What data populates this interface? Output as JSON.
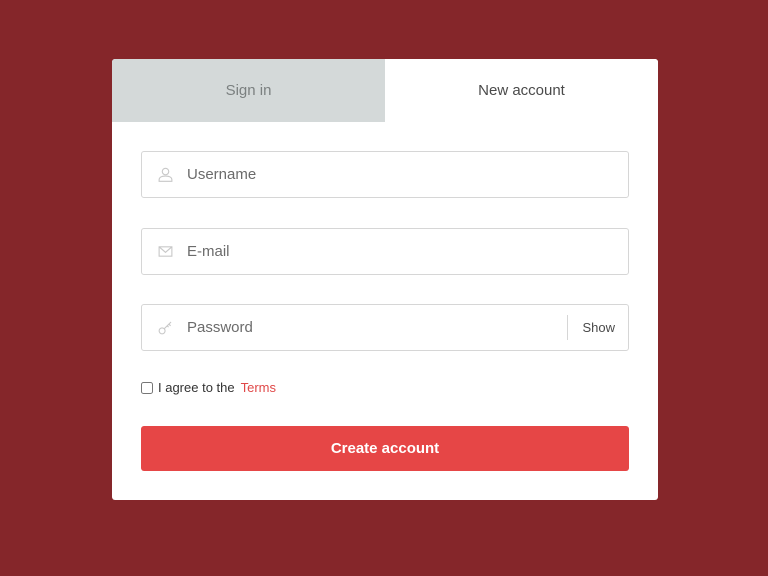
{
  "tabs": {
    "sign_in": "Sign in",
    "new_account": "New account"
  },
  "form": {
    "username_placeholder": "Username",
    "email_placeholder": "E-mail",
    "password_placeholder": "Password",
    "show_label": "Show",
    "agree_text": "I agree to the",
    "terms_label": "Terms",
    "terms_checked": false,
    "submit_label": "Create account"
  },
  "icons": {
    "username": "user-icon",
    "email": "mail-icon",
    "password": "key-icon"
  },
  "colors": {
    "background": "#85262a",
    "accent": "#e64646",
    "terms_link": "#e04848",
    "inactive_tab": "#d4d9d9"
  }
}
